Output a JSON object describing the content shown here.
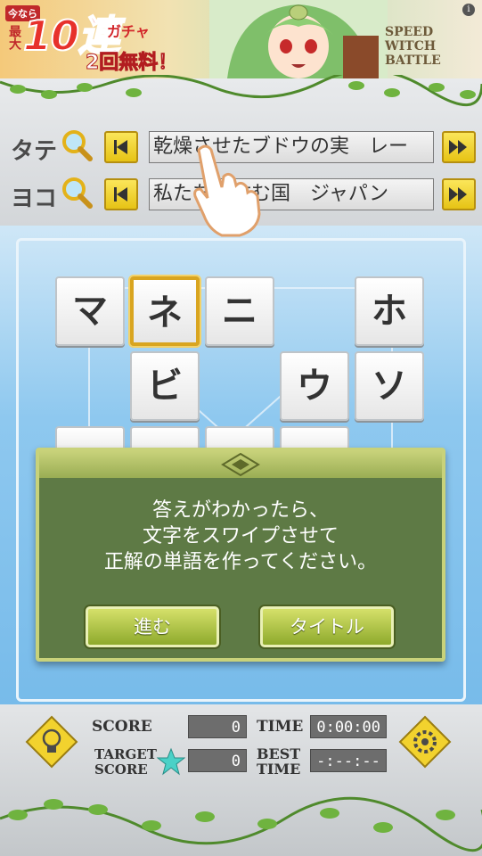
{
  "ad": {
    "promo_top": "今なら",
    "promo_side": "最大",
    "big_text": "10連",
    "gacha_text": "ガチャ",
    "free_text": "2回無料！",
    "logo_text": "SPEED WITCH BATTLE",
    "info_glyph": "i"
  },
  "clues": {
    "vertical": {
      "label": "タテ",
      "text": "乾燥させたブドウの実　レー"
    },
    "horizontal": {
      "label": "ヨコ",
      "text": "私たちの住む国　ジャパン"
    }
  },
  "tiles": {
    "r1": [
      "マ",
      "ネ",
      "ニ",
      "ホ"
    ],
    "r2": [
      "ビ",
      "ウ",
      "ソ"
    ]
  },
  "dialog": {
    "line1": "答えがわかったら、",
    "line2": "文字をスワイプさせて",
    "line3": "正解の単語を作ってください。",
    "next_button": "進む",
    "title_button": "タイトル"
  },
  "scores": {
    "score_label": "SCORE",
    "score_value": "0",
    "time_label": "TIME",
    "time_value": "0:00:00",
    "target_label_1": "TARGET",
    "target_label_2": "SCORE",
    "target_value": "0",
    "best_label_1": "BEST",
    "best_label_2": "TIME",
    "best_value": "-:--:--"
  },
  "icons": [
    "hint-lightbulb-icon",
    "settings-gear-icon",
    "magnifier-icon",
    "prev-arrow-icon",
    "next-arrow-icon",
    "star-icon",
    "tutorial-hand-icon"
  ],
  "colors": {
    "accent_yellow": "#f2d22e",
    "dialog_green": "#5e7a45",
    "button_green": "#a9c03c",
    "board_blue": "#8ec8ef"
  }
}
